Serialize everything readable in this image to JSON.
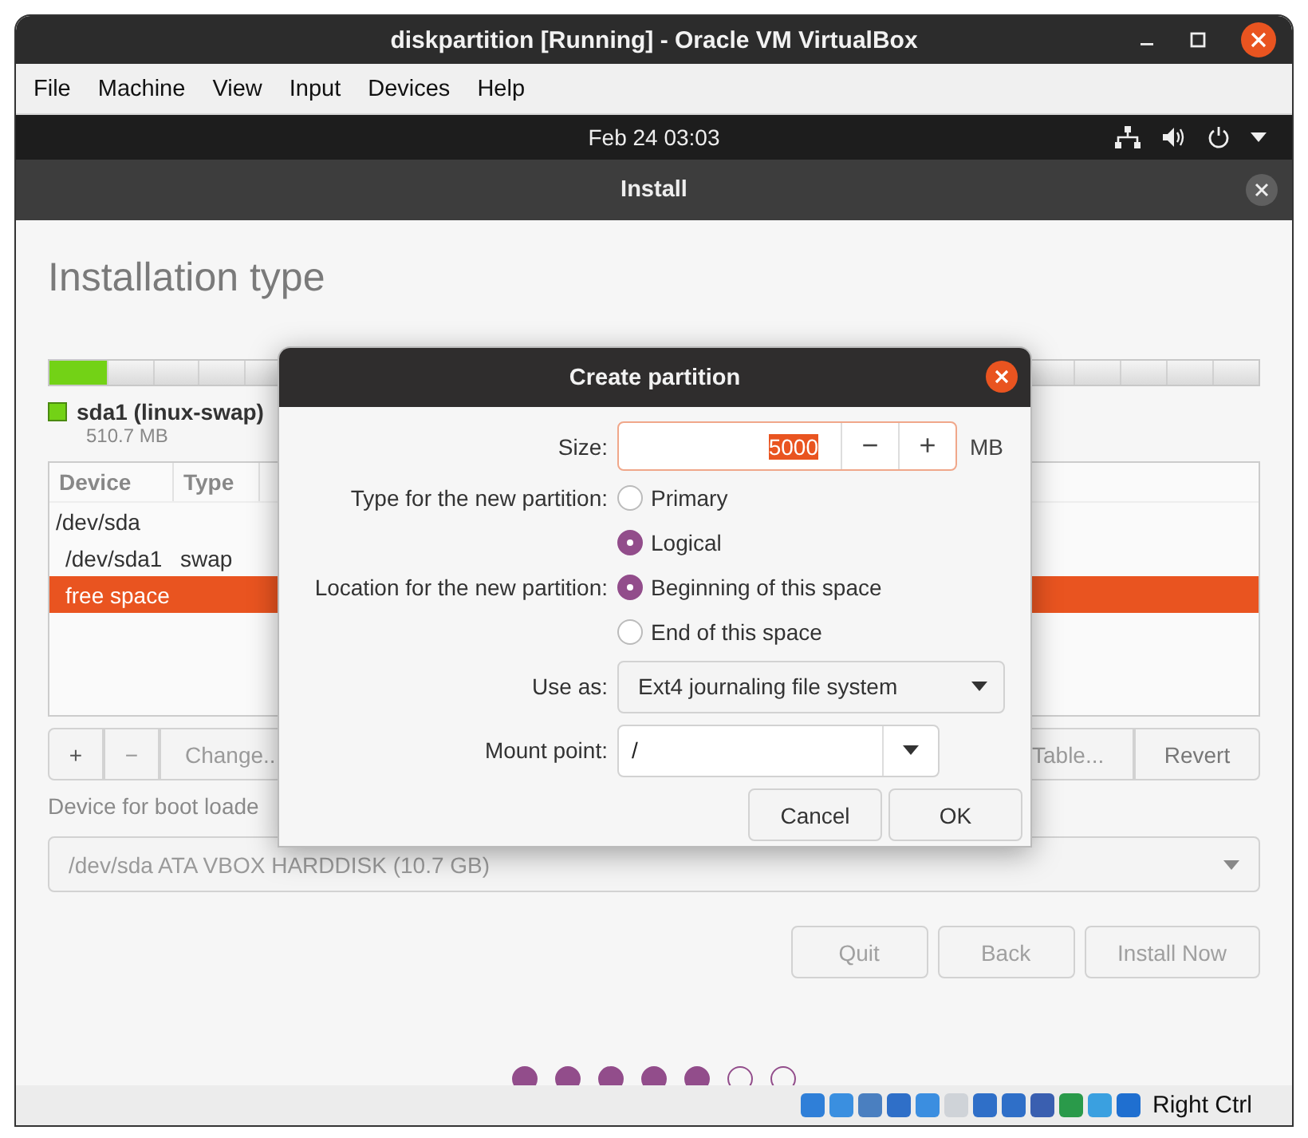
{
  "window": {
    "title": "diskpartition [Running] - Oracle VM VirtualBox"
  },
  "menu": [
    "File",
    "Machine",
    "View",
    "Input",
    "Devices",
    "Help"
  ],
  "top_bar": {
    "clock": "Feb 24  03:03"
  },
  "installer": {
    "title": "Install",
    "heading": "Installation type",
    "partition_bar": {
      "level": 0.047,
      "color": "#73d216"
    },
    "legend": {
      "name": "sda1 (linux-swap)",
      "size": "510.7 MB",
      "color": "#73d216"
    },
    "table": {
      "columns": [
        "Device",
        "Type"
      ],
      "rows": [
        {
          "device": "/dev/sda",
          "selected": false,
          "children": [
            {
              "device": "/dev/sda1",
              "type": "swap",
              "selected": false
            },
            {
              "device": "free space",
              "selected": true
            }
          ]
        }
      ]
    },
    "toolbar": [
      {
        "label": "+",
        "disabled": false
      },
      {
        "label": "−",
        "disabled": true
      },
      {
        "label": "Change..",
        "disabled": true
      },
      {
        "label": "Table...",
        "disabled": true
      },
      {
        "label": "Revert",
        "disabled": false
      }
    ],
    "boot_label": "Device for boot loade",
    "boot_device": {
      "value": "/dev/sda ATA VBOX HARDDISK (10.7 GB)",
      "disabled": true
    },
    "buttons": [
      {
        "label": "Quit",
        "disabled": true
      },
      {
        "label": "Back",
        "disabled": true
      },
      {
        "label": "Install Now",
        "disabled": true
      }
    ],
    "steps": [
      {
        "done": true
      },
      {
        "done": true
      },
      {
        "done": true
      },
      {
        "done": true
      },
      {
        "done": true
      },
      {
        "done": false
      },
      {
        "done": false
      }
    ]
  },
  "dialog": {
    "title": "Create partition",
    "size": {
      "label": "Size:",
      "value": "5000",
      "minus": "−",
      "plus": "+",
      "unit": "MB"
    },
    "type": {
      "label": "Type for the new partition:",
      "options": [
        {
          "label": "Primary",
          "selected": false
        },
        {
          "label": "Logical",
          "selected": true
        }
      ]
    },
    "location": {
      "label": "Location for the new partition:",
      "options": [
        {
          "label": "Beginning of this space",
          "selected": true
        },
        {
          "label": "End of this space",
          "selected": false
        }
      ]
    },
    "use_as": {
      "label": "Use as:",
      "value": "Ext4 journaling file system"
    },
    "mount": {
      "label": "Mount point:",
      "value": "/"
    },
    "buttons": [
      "Cancel",
      "OK"
    ]
  },
  "status_bar": {
    "host_key": "Right Ctrl"
  }
}
